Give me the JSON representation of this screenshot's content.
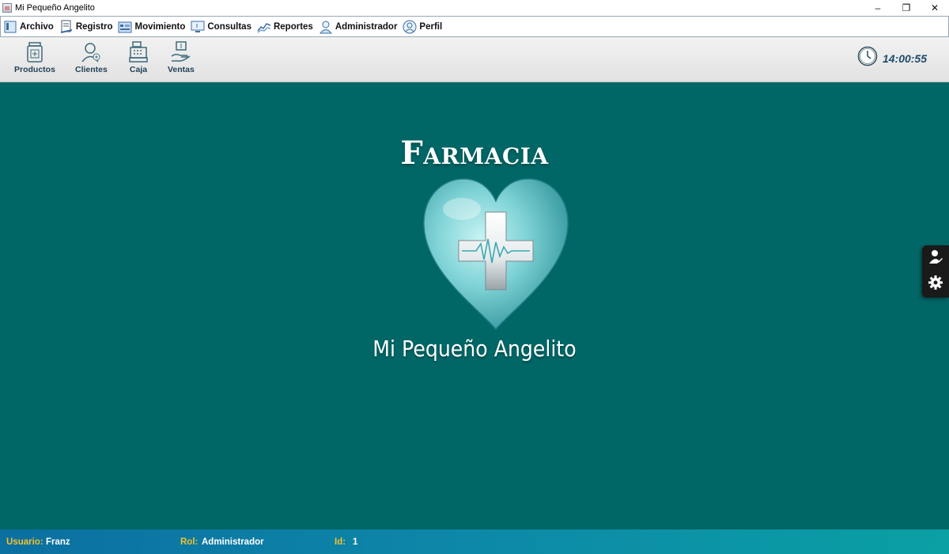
{
  "window": {
    "title": "Mi Pequeño Angelito",
    "minimize": "–",
    "restore": "❐",
    "close": "✕"
  },
  "menu": [
    {
      "label": "Archivo",
      "icon": "archive-icon"
    },
    {
      "label": "Registro",
      "icon": "register-icon"
    },
    {
      "label": "Movimiento",
      "icon": "movement-icon"
    },
    {
      "label": "Consultas",
      "icon": "monitor-icon"
    },
    {
      "label": "Reportes",
      "icon": "chart-icon"
    },
    {
      "label": "Administrador",
      "icon": "user-icon"
    },
    {
      "label": "Perfil",
      "icon": "profile-icon"
    }
  ],
  "toolbar": [
    {
      "label": "Productos",
      "icon": "products-icon"
    },
    {
      "label": "Clientes",
      "icon": "clients-icon"
    },
    {
      "label": "Caja",
      "icon": "cash-register-icon"
    },
    {
      "label": "Ventas",
      "icon": "sales-icon"
    }
  ],
  "clock": {
    "time": "14:00:55",
    "icon": "clock-icon"
  },
  "logo": {
    "title": "Farmacia",
    "subtitle": "Mi Pequeño Angelito"
  },
  "side_tab": [
    {
      "icon": "user-edit-icon"
    },
    {
      "icon": "gear-icon"
    }
  ],
  "status": {
    "user_label": "Usuario:",
    "user_value": "Franz",
    "role_label": "Rol:",
    "role_value": "Administrador",
    "id_label": "Id:",
    "id_value": "1"
  },
  "colors": {
    "main_bg": "#006666",
    "status_label": "#f2c12e",
    "status_value": "#ffffff",
    "clock_text": "#1e4c6a"
  }
}
